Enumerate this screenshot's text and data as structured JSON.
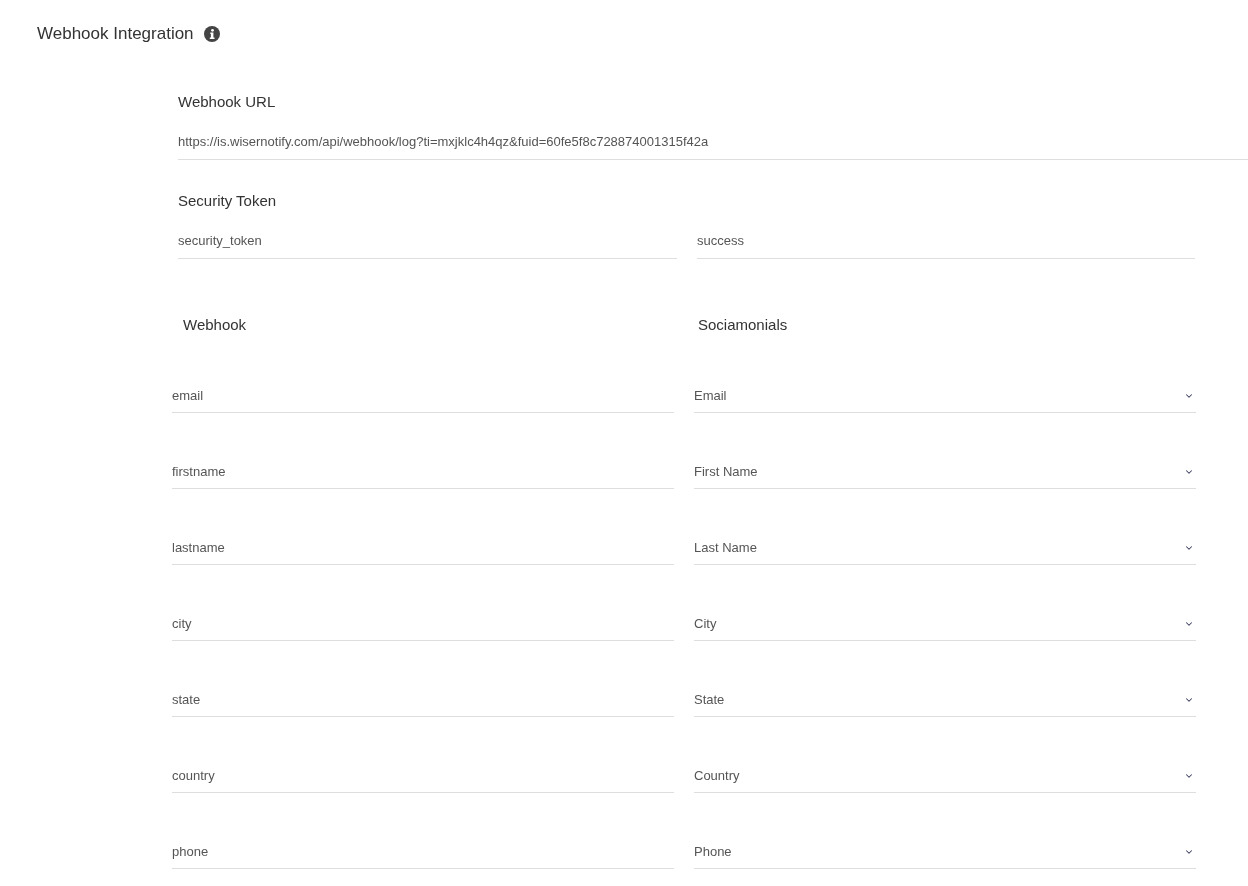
{
  "header": {
    "title": "Webhook Integration"
  },
  "webhook_url": {
    "label": "Webhook URL",
    "value": "https://is.wisernotify.com/api/webhook/log?ti=mxjklc4h4qz&fuid=60fe5f8c728874001315f42a"
  },
  "security_token": {
    "label": "Security Token",
    "key_value": "security_token",
    "value": "success"
  },
  "mapping": {
    "column_headings": [
      "Webhook",
      "Sociamonials"
    ],
    "rows": [
      {
        "webhook_field": "email",
        "sociamonials_field": "Email"
      },
      {
        "webhook_field": "firstname",
        "sociamonials_field": "First Name"
      },
      {
        "webhook_field": "lastname",
        "sociamonials_field": "Last Name"
      },
      {
        "webhook_field": "city",
        "sociamonials_field": "City"
      },
      {
        "webhook_field": "state",
        "sociamonials_field": "State"
      },
      {
        "webhook_field": "country",
        "sociamonials_field": "Country"
      },
      {
        "webhook_field": "phone",
        "sociamonials_field": "Phone"
      }
    ]
  }
}
